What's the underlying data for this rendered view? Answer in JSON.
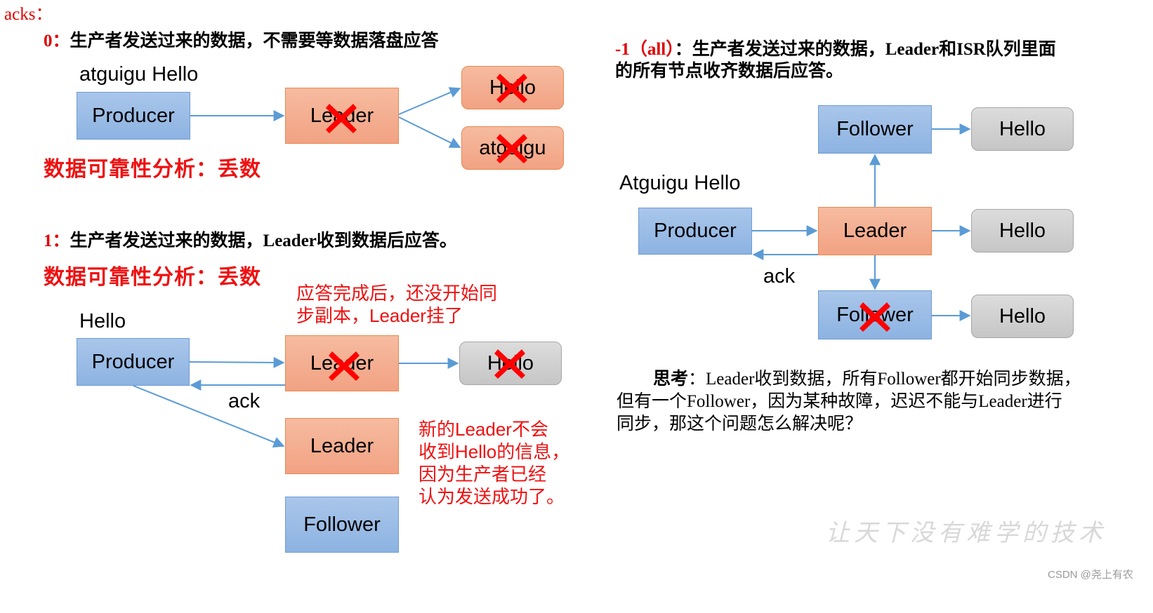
{
  "header": {
    "label": "acks："
  },
  "section0": {
    "prefix": "0：",
    "text": "生产者发送过来的数据，不需要等数据落盘应答",
    "data_label": "atguigu  Hello",
    "producer": "Producer",
    "leader": "Leader",
    "replica_top": "Hello",
    "replica_bottom": "atguigu",
    "analysis": "数据可靠性分析：丢数"
  },
  "section1": {
    "prefix": "1：",
    "text": "生产者发送过来的数据，Leader收到数据后应答。",
    "analysis": "数据可靠性分析：丢数",
    "note_top": [
      "应答完成后，还没开始同",
      "步副本，Leader挂了"
    ],
    "data_label": "Hello",
    "producer": "Producer",
    "leader_failed": "Leader",
    "replica": "Hello",
    "ack": "ack",
    "new_leader": "Leader",
    "follower": "Follower",
    "note_bottom": [
      "新的Leader不会",
      "收到Hello的信息，",
      "因为生产者已经",
      "认为发送成功了。"
    ]
  },
  "section_all": {
    "prefix": "-1（all）",
    "text_line1": "：生产者发送过来的数据，Leader和ISR队列里面",
    "text_line2": "的所有节点收齐数据后应答。",
    "data_label": "Atguigu Hello",
    "producer": "Producer",
    "leader": "Leader",
    "follower_top": "Follower",
    "follower_bottom": "Follower",
    "replica_top": "Hello",
    "replica_mid": "Hello",
    "replica_bottom": "Hello",
    "ack": "ack"
  },
  "thinking": {
    "label": "思考",
    "line1": "：Leader收到数据，所有Follower都开始同步数据，",
    "line2": "但有一个Follower，因为某种故障，迟迟不能与Leader进行",
    "line3": "同步，那这个问题怎么解决呢？"
  },
  "watermark": "让天下没有难学的技术",
  "credit": "CSDN @尧上有农",
  "colors": {
    "accent_red": "#e00000",
    "producer_blue": "#8db3e2",
    "leader_orange": "#f2a283",
    "replica_gray": "#c6c6c6",
    "arrow_blue": "#5b9bd5",
    "fail_x": "#ff0000"
  }
}
